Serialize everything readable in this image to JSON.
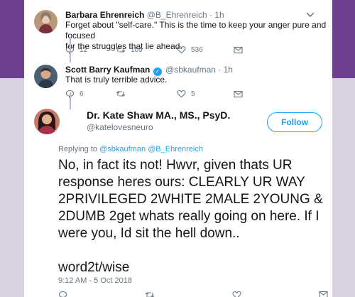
{
  "tweets": [
    {
      "name": "Barbara Ehrenreich",
      "handle": "@B_Ehrenreich",
      "time": "· 1h",
      "text_line1": "Forget about \"self-care.\" This is the time to keep your anger pure and focused",
      "text_line2": "for the struggles that lie ahead.",
      "replies": "12",
      "retweets": "109",
      "likes": "536"
    },
    {
      "name": "Scott Barry Kaufman",
      "handle": "@sbkaufman",
      "time": "· 1h",
      "text": "That is truly terrible advice.",
      "replies": "6",
      "retweets": "",
      "likes": "5"
    }
  ],
  "main_tweet": {
    "name": "Dr. Kate Shaw MA., MS., PsyD.",
    "handle": "@katelovesneuro",
    "follow_label": "Follow",
    "replying_prefix": "Replying to",
    "replying_to": "@sbkaufman @B_Ehrenreich",
    "text_lines": [
      "No, in fact its not! Hwvr, given thats UR",
      "response heres ours: CLEARLY UR WAY",
      "2PRIVILEGED 2WHITE 2MALE 2YOUNG &",
      "2DUMB 2get whats really going on here. If I",
      "were you, Id sit the hell down.."
    ],
    "signoff": "word2t/wise",
    "timestamp": "9:12 AM - 5 Oct 2018"
  },
  "colors": {
    "accent": "#1da1f2",
    "banner": "#6e3f8f",
    "thread_line": "#c4b5d2"
  },
  "icons": [
    "chevron-down-icon",
    "reply-icon",
    "retweet-icon",
    "like-icon",
    "message-icon",
    "verified-icon"
  ]
}
